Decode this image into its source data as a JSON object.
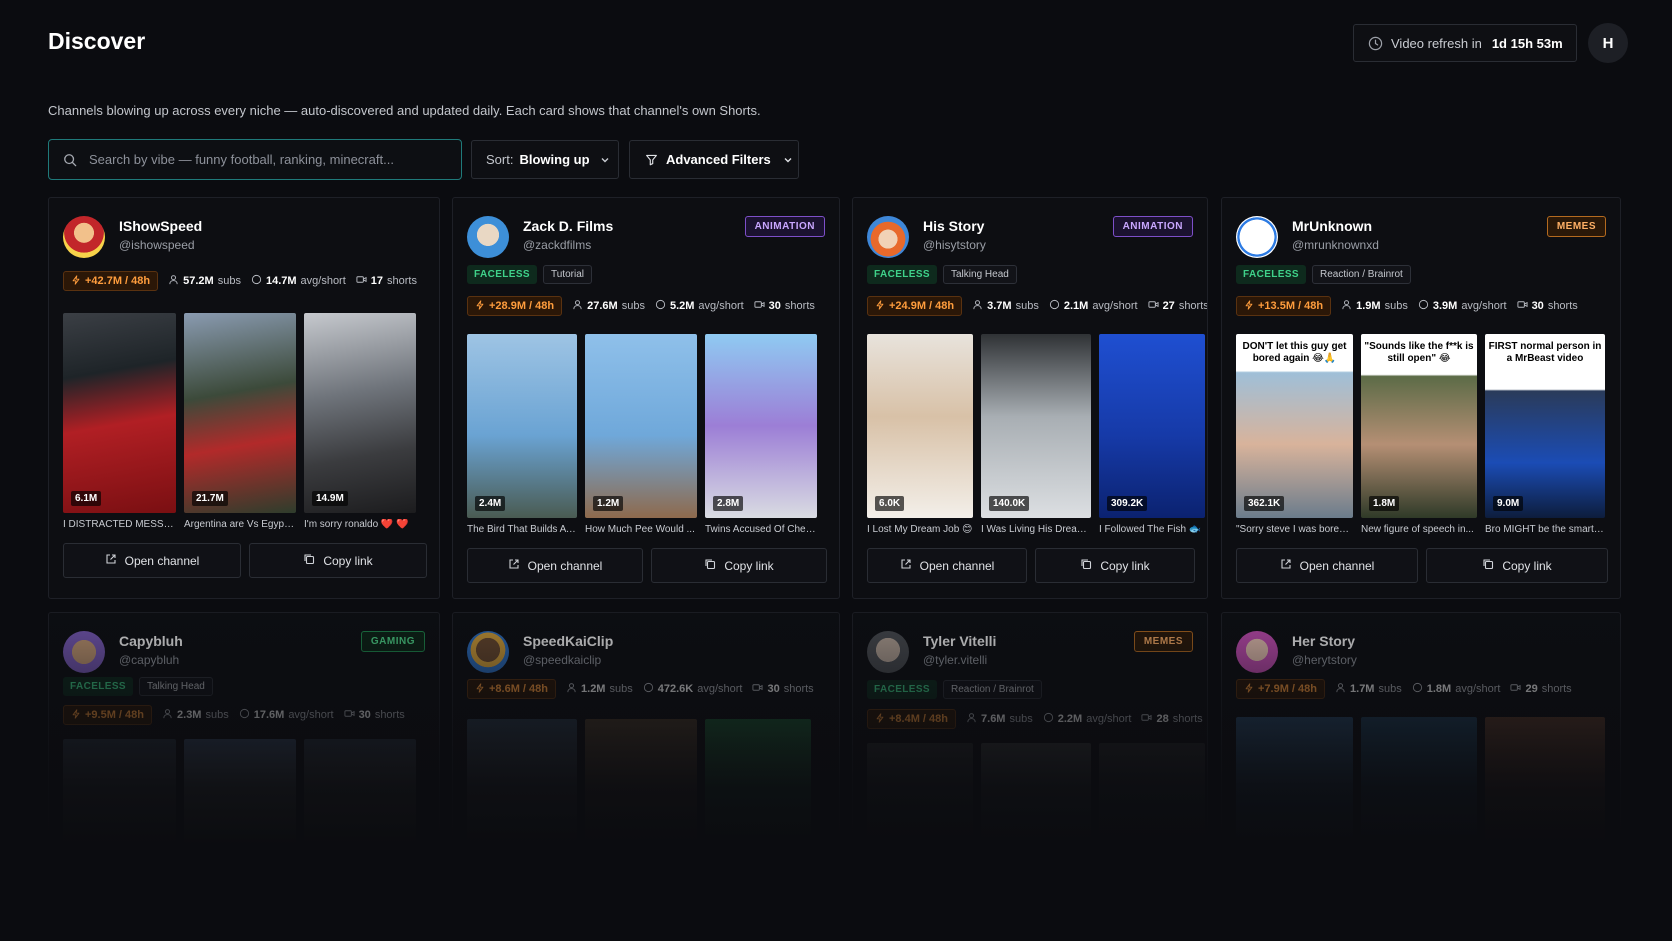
{
  "header": {
    "title": "Discover",
    "refresh_label": "Video refresh in",
    "refresh_value": "1d 15h 53m",
    "user_initial": "H"
  },
  "subtitle": "Channels blowing up across every niche — auto-discovered and updated daily. Each card shows that channel's own Shorts.",
  "search": {
    "placeholder": "Search by vibe — funny football, ranking, minecraft..."
  },
  "sort": {
    "label": "Sort:",
    "value": "Blowing up"
  },
  "filters": {
    "label": "Advanced Filters"
  },
  "labels": {
    "open_channel": "Open channel",
    "copy_link": "Copy link",
    "subs": "subs",
    "avg": "avg/short",
    "shorts": "shorts"
  },
  "cards": [
    {
      "name": "IShowSpeed",
      "handle": "@ishowspeed",
      "niche": "",
      "tags": [],
      "growth": "+42.7M / 48h",
      "subs": "57.2M",
      "avg": "14.7M",
      "shorts": "17",
      "videos": [
        {
          "views": "6.1M",
          "caption": "I DISTRACTED MESSI 😳 ...",
          "overlay": ""
        },
        {
          "views": "21.7M",
          "caption": "Argentina are Vs Egypt t...",
          "overlay": ""
        },
        {
          "views": "14.9M",
          "caption": "I'm sorry ronaldo ❤️ ❤️",
          "overlay": ""
        }
      ]
    },
    {
      "name": "Zack D. Films",
      "handle": "@zackdfilms",
      "niche": "ANIMATION",
      "tags": [
        "FACELESS",
        "Tutorial"
      ],
      "growth": "+28.9M / 48h",
      "subs": "27.6M",
      "avg": "5.2M",
      "shorts": "30",
      "videos": [
        {
          "views": "2.4M",
          "caption": "The Bird That Builds A Fo...",
          "overlay": ""
        },
        {
          "views": "1.2M",
          "caption": "How Much Pee Would ...",
          "overlay": ""
        },
        {
          "views": "2.8M",
          "caption": "Twins Accused Of Cheatin...",
          "overlay": ""
        }
      ]
    },
    {
      "name": "His Story",
      "handle": "@hisytstory",
      "niche": "ANIMATION",
      "tags": [
        "FACELESS",
        "Talking Head"
      ],
      "growth": "+24.9M / 48h",
      "subs": "3.7M",
      "avg": "2.1M",
      "shorts": "27",
      "videos": [
        {
          "views": "6.0K",
          "caption": "I Lost My Dream Job 😊",
          "overlay": ""
        },
        {
          "views": "140.0K",
          "caption": "I Was Living His Dream 😊",
          "overlay": ""
        },
        {
          "views": "309.2K",
          "caption": "I Followed The Fish 🐟",
          "overlay": ""
        }
      ]
    },
    {
      "name": "MrUnknown",
      "handle": "@mrunknownxd",
      "niche": "MEMES",
      "tags": [
        "FACELESS",
        "Reaction / Brainrot"
      ],
      "growth": "+13.5M / 48h",
      "subs": "1.9M",
      "avg": "3.9M",
      "shorts": "30",
      "videos": [
        {
          "views": "362.1K",
          "caption": "\"Sorry steve I was bored\" ...",
          "overlay": "DON'T let this guy get bored again 😂🙏"
        },
        {
          "views": "1.8M",
          "caption": "New figure of speech in...",
          "overlay": "\"Sounds like the f**k is still open\" 😂"
        },
        {
          "views": "9.0M",
          "caption": "Bro MIGHT be the smarte...",
          "overlay": "FIRST normal person in a MrBeast video"
        }
      ]
    },
    {
      "name": "Capybluh",
      "handle": "@capybluh",
      "niche": "GAMING",
      "tags": [
        "FACELESS",
        "Talking Head"
      ],
      "growth": "+9.5M / 48h",
      "subs": "2.3M",
      "avg": "17.6M",
      "shorts": "30",
      "videos": [
        {
          "views": ""
        },
        {
          "views": ""
        },
        {
          "views": ""
        }
      ]
    },
    {
      "name": "SpeedKaiClip",
      "handle": "@speedkaiclip",
      "niche": "",
      "tags": [],
      "growth": "+8.6M / 48h",
      "subs": "1.2M",
      "avg": "472.6K",
      "shorts": "30",
      "videos": [
        {
          "views": ""
        },
        {
          "views": ""
        },
        {
          "views": ""
        }
      ]
    },
    {
      "name": "Tyler Vitelli",
      "handle": "@tyler.vitelli",
      "niche": "MEMES",
      "tags": [
        "FACELESS",
        "Reaction / Brainrot"
      ],
      "growth": "+8.4M / 48h",
      "subs": "7.6M",
      "avg": "2.2M",
      "shorts": "28",
      "videos": [
        {
          "views": ""
        },
        {
          "views": ""
        },
        {
          "views": ""
        }
      ]
    },
    {
      "name": "Her Story",
      "handle": "@herytstory",
      "niche": "",
      "tags": [],
      "growth": "+7.9M / 48h",
      "subs": "1.7M",
      "avg": "1.8M",
      "shorts": "29",
      "videos": [
        {
          "views": ""
        },
        {
          "views": ""
        },
        {
          "views": ""
        }
      ]
    }
  ]
}
